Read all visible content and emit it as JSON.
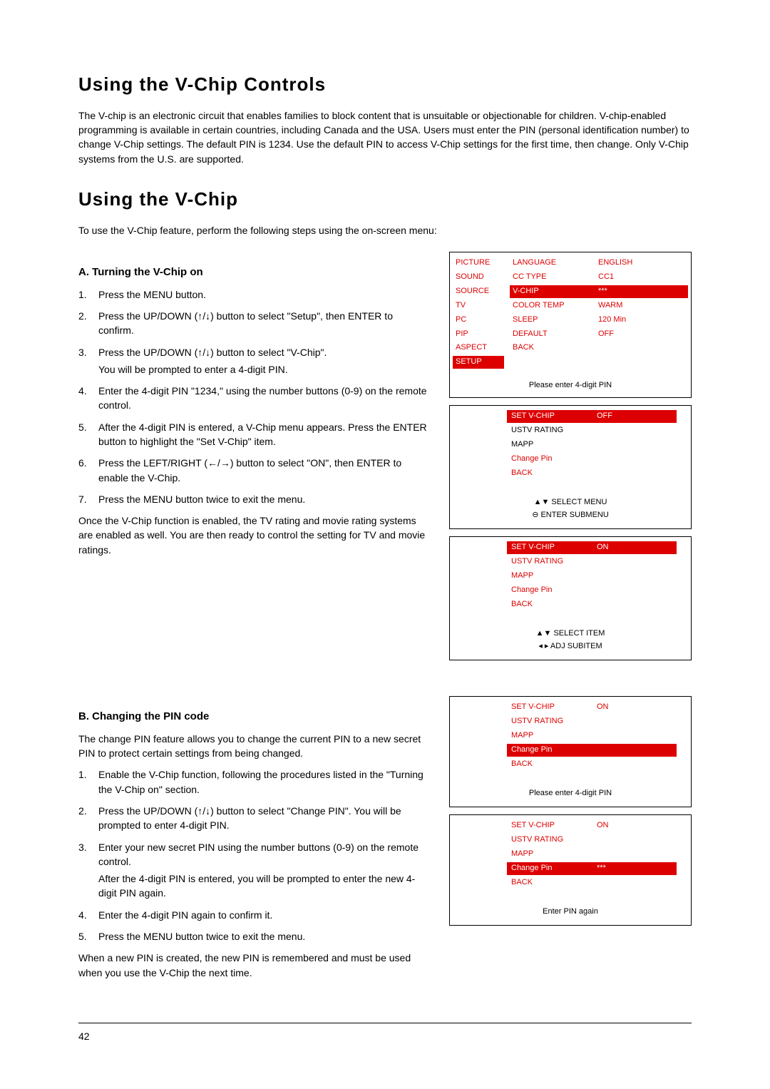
{
  "h1": "Using the V-Chip Controls",
  "intro": "The V-chip is an electronic circuit that enables families to block content that is unsuitable or objectionable for children. V-chip-enabled programming is available in certain countries, including Canada and the USA. Users must enter the PIN (personal identification number) to change V-Chip settings. The default PIN is 1234. Use the default PIN to access V-Chip settings for the first time, then change. Only V-Chip systems from the U.S. are supported.",
  "h2": "Using the V-Chip",
  "h2_intro": "To use the V-Chip feature, perform the following steps using the on-screen menu:",
  "secA": {
    "title": "A. Turning the V-Chip on",
    "steps": [
      "Press the MENU button.",
      "Press the UP/DOWN (↑/↓) button to select \"Setup\", then ENTER to confirm.",
      "Press the UP/DOWN (↑/↓) button to select \"V-Chip\".",
      "Enter the 4-digit PIN \"1234,\" using the number buttons (0-9) on the remote control.",
      "After the 4-digit PIN is entered, a V-Chip menu appears. Press the ENTER button to highlight the \"Set V-Chip\" item.",
      "Press the LEFT/RIGHT (←/→) button to select \"ON\", then ENTER to enable the V-Chip.",
      "Press the MENU button twice to exit the menu."
    ],
    "step3_sub": "You will be prompted to enter a 4-digit PIN.",
    "after": "Once the V-Chip function is enabled, the TV rating and movie rating systems are enabled as well. You are then ready to control the setting for TV and movie ratings."
  },
  "secB": {
    "title": "B. Changing the PIN code",
    "intro": "The change PIN feature allows you to change the current PIN to a new secret PIN to protect certain settings from being changed.",
    "steps": [
      "Enable the V-Chip function, following the procedures listed in the \"Turning the V-Chip on\" section.",
      "Press the UP/DOWN (↑/↓) button to select \"Change PIN\". You will be prompted to enter 4-digit PIN.",
      "Enter your new secret PIN using the number buttons (0-9) on the remote control.",
      "Enter the 4-digit PIN again to confirm it.",
      "Press the MENU button twice to exit the menu."
    ],
    "step3_sub": "After the 4-digit PIN is entered, you will be prompted to enter the new 4-digit PIN again.",
    "after": "When a new PIN is created, the new PIN is remembered and must be used when you use the V-Chip the next time."
  },
  "osd1": {
    "sidebar": [
      "PICTURE",
      "SOUND",
      "SOURCE",
      "TV",
      "PC",
      "PIP",
      "ASPECT",
      "SETUP"
    ],
    "sidebar_sel": 7,
    "rows": [
      {
        "lbl": "LANGUAGE",
        "val": "ENGLISH"
      },
      {
        "lbl": "CC TYPE",
        "val": "CC1"
      },
      {
        "lbl": "V-CHIP",
        "val": "***",
        "sel": true
      },
      {
        "lbl": "COLOR TEMP",
        "val": "WARM"
      },
      {
        "lbl": "SLEEP",
        "val": "120 Min"
      },
      {
        "lbl": "DEFAULT",
        "val": "OFF"
      },
      {
        "lbl": "BACK",
        "val": ""
      }
    ],
    "footer": "Please enter 4-digit PIN"
  },
  "osd2": {
    "items": [
      {
        "lbl": "SET V-CHIP",
        "val": "OFF",
        "sel": true
      },
      {
        "lbl": "USTV RATING",
        "black": true
      },
      {
        "lbl": "MAPP",
        "black": true
      },
      {
        "lbl": "Change Pin"
      },
      {
        "lbl": "BACK"
      }
    ],
    "footer": [
      "▲▼  SELECT MENU",
      "⊖  ENTER SUBMENU"
    ]
  },
  "osd3": {
    "items": [
      {
        "lbl": "SET V-CHIP",
        "val": "ON",
        "sel": true
      },
      {
        "lbl": "USTV RATING"
      },
      {
        "lbl": "MAPP"
      },
      {
        "lbl": "Change Pin"
      },
      {
        "lbl": "BACK"
      }
    ],
    "footer": [
      "▲▼  SELECT ITEM",
      "◂ ▸  ADJ SUBITEM"
    ]
  },
  "osd4": {
    "items": [
      {
        "lbl": "SET V-CHIP",
        "val": "ON"
      },
      {
        "lbl": "USTV RATING"
      },
      {
        "lbl": "MAPP"
      },
      {
        "lbl": "Change Pin",
        "sel": true
      },
      {
        "lbl": "BACK"
      }
    ],
    "footer": [
      "Please enter 4-digit PIN"
    ]
  },
  "osd5": {
    "items": [
      {
        "lbl": "SET V-CHIP",
        "val": "ON"
      },
      {
        "lbl": "USTV RATING"
      },
      {
        "lbl": "MAPP"
      },
      {
        "lbl": "Change Pin",
        "val": "***",
        "sel": true
      },
      {
        "lbl": "BACK"
      }
    ],
    "footer": [
      "Enter PIN again"
    ]
  },
  "page_number": "42"
}
